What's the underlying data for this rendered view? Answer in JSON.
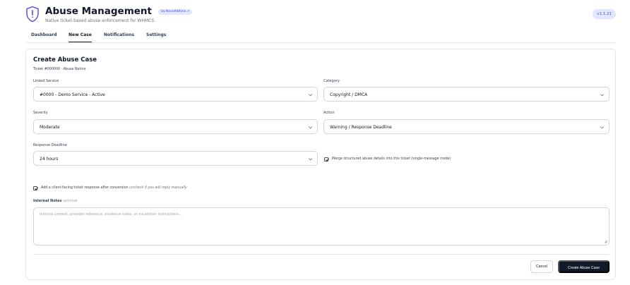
{
  "header": {
    "title": "Abuse Management",
    "badge": "by NovoAddons ↗",
    "subtitle": "Native ticket-based abuse enforcement for WHMCS.",
    "version": "v1.1.21",
    "logo_icon": "shield-exclamation-icon"
  },
  "tabs": [
    {
      "label": "Dashboard",
      "active": false
    },
    {
      "label": "New Case",
      "active": true
    },
    {
      "label": "Notifications",
      "active": false
    },
    {
      "label": "Settings",
      "active": false
    }
  ],
  "form": {
    "title": "Create Abuse Case",
    "ticket_ref": "Ticket #000000 · Abuse Notice",
    "linked_service": {
      "label": "Linked Service",
      "value": "#0000 - Demo Service - Active"
    },
    "category": {
      "label": "Category",
      "value": "Copyright / DMCA"
    },
    "severity": {
      "label": "Severity",
      "value": "Moderate"
    },
    "action": {
      "label": "Action",
      "value": "Warning / Response Deadline"
    },
    "response_deadline": {
      "label": "Response Deadline",
      "value": "24 hours"
    },
    "merge_checkbox": {
      "label": "Merge structured abuse details into this ticket (single-message mode)",
      "checked": true
    },
    "client_response_checkbox": {
      "label": "Add a client-facing ticket response after conversion",
      "hint": "uncheck if you will reply manually",
      "checked": true
    },
    "internal_notes": {
      "label": "Internal Notes",
      "optional": "optional",
      "placeholder": "Internal context, provider reference, evidence notes, or escalation instructions..."
    },
    "cancel_label": "Cancel",
    "submit_label": "Create Abuse Case"
  },
  "colors": {
    "accent": "#4f46e5",
    "accent_bg": "#e0e7ff",
    "primary_button": "#111827",
    "border": "#d1d5db"
  }
}
